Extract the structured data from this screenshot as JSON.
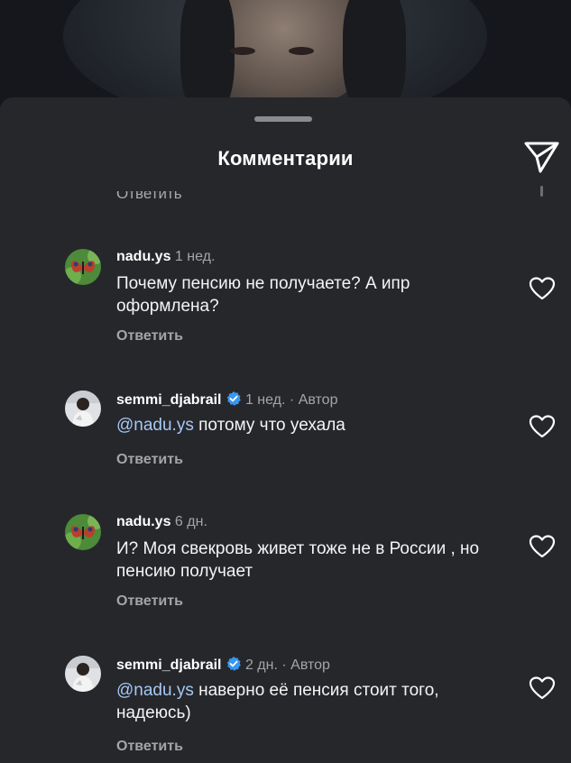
{
  "sheet": {
    "title": "Комментарии",
    "cut_reply_label": "Ответить"
  },
  "comments": [
    {
      "username": "nadu.ys",
      "time": "1 нед.",
      "verified": false,
      "author_badge": "",
      "mention": "",
      "text": "Почему пенсию не получаете? А ипр оформлена?",
      "reply_label": "Ответить"
    },
    {
      "username": "semmi_djabrail",
      "time": "1 нед.",
      "verified": true,
      "dot": "·",
      "author_badge": "Автор",
      "mention": "@nadu.ys",
      "text": "потому что уехала",
      "reply_label": "Ответить"
    },
    {
      "username": "nadu.ys",
      "time": "6 дн.",
      "verified": false,
      "author_badge": "",
      "mention": "",
      "text": "И? Моя свекровь живет тоже не в России , но пенсию получает",
      "reply_label": "Ответить"
    },
    {
      "username": "semmi_djabrail",
      "time": "2 дн.",
      "verified": true,
      "dot": "·",
      "author_badge": "Автор",
      "mention": "@nadu.ys",
      "text": "наверно её пенсия стоит того, надеюсь)",
      "reply_label": "Ответить"
    }
  ],
  "icons": {
    "share": "paper-plane-icon",
    "like": "heart-outline-icon",
    "verified": "verified-badge-icon"
  },
  "colors": {
    "background": "#26272b",
    "mention": "#a6c8f5",
    "verified": "#3897f0",
    "muted": "#a4a5a9"
  }
}
